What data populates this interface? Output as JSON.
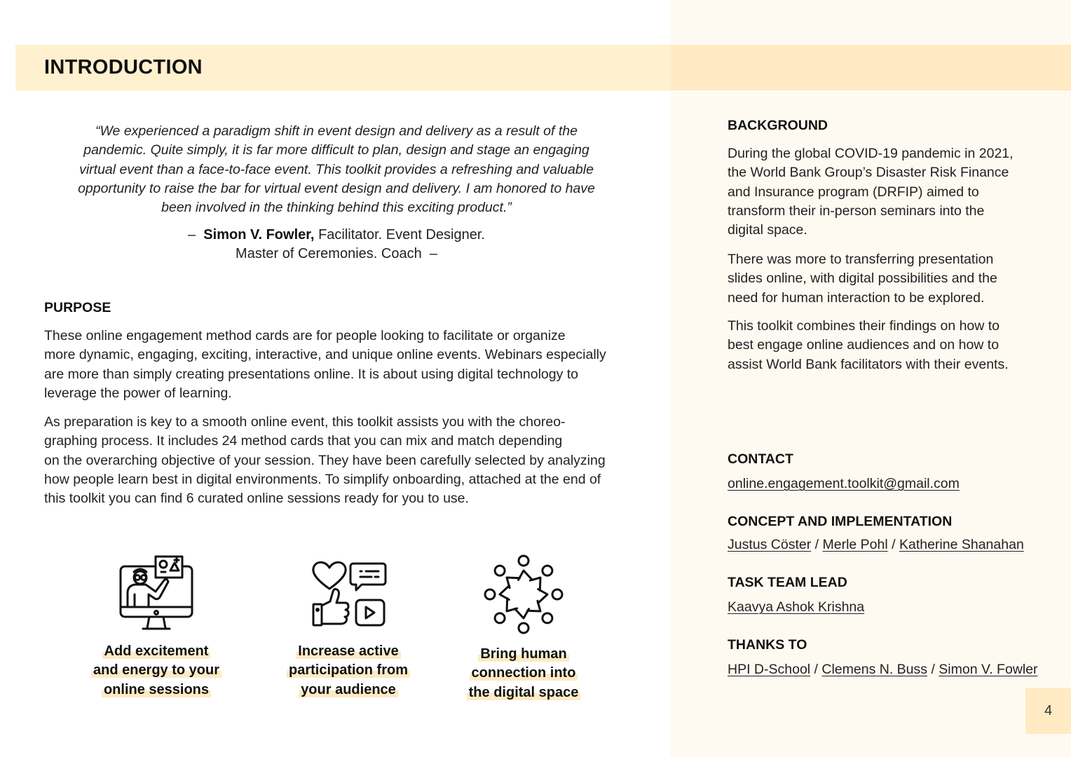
{
  "header": {
    "title": "INTRODUCTION"
  },
  "quote": {
    "lines": [
      "“We experienced a paradigm shift in event design and delivery as a result of the",
      "pandemic. Quite simply, it is far more difficult to plan, design and stage an engaging",
      "virtual event than a face-to-face event. This toolkit provides a refreshing and valuable",
      "opportunity to raise the bar for virtual event design and delivery. I am honored to have",
      "been involved in the thinking behind this exciting product.”"
    ],
    "dash": "–",
    "author": "Simon V. Fowler,",
    "role_line1": "Facilitator. Event Designer.",
    "role_line2": "Master of Ceremonies. Coach"
  },
  "purpose": {
    "heading": "PURPOSE",
    "paragraph1_lines": [
      "These online engagement method cards are for people looking to facilitate or organize",
      "more dynamic, engaging, exciting, interactive, and unique online events. Webinars especially",
      "are more than simply creating presentations online. It is about using digital technology to",
      "leverage the power of learning."
    ],
    "paragraph2_lines": [
      "As preparation is key to a smooth online event, this toolkit assists you with the choreo-",
      "graphing process. It includes 24 method cards that you can mix and match depending",
      "on the overarching objective of your session. They have been carefully selected by analyzing",
      "how people learn best in digital environments. To simplify onboarding, attached at the end of",
      "this toolkit you can find 6 curated online sessions ready for you to use."
    ]
  },
  "features": [
    {
      "icon": "presenter-screen-icon",
      "lines": [
        "Add excitement",
        "and energy to your",
        "online sessions"
      ]
    },
    {
      "icon": "engagement-reactions-icon",
      "lines": [
        "Increase active",
        "participation from",
        "your audience"
      ]
    },
    {
      "icon": "people-circle-icon",
      "lines": [
        "Bring human",
        "connection into",
        "the digital space"
      ]
    }
  ],
  "background": {
    "heading": "BACKGROUND",
    "paragraph1_lines": [
      "During the global COVID-19 pandemic in 2021,",
      "the World Bank Group’s Disaster Risk Finance",
      "and Insurance program (DRFIP) aimed to",
      "transform their in-person seminars into the",
      "digital space."
    ],
    "paragraph2_lines": [
      "There was more to transferring presentation",
      "slides online, with digital possibilities and the",
      "need for human interaction to be explored."
    ],
    "paragraph3_lines": [
      "This toolkit combines their findings on how to",
      "best engage online audiences and on how to",
      "assist World Bank facilitators with their events."
    ]
  },
  "contact": {
    "heading": "CONTACT",
    "email": "online.engagement.toolkit@gmail.com"
  },
  "concept": {
    "heading": "CONCEPT AND IMPLEMENTATION",
    "names": [
      "Justus Cöster",
      "Merle Pohl",
      "Katherine Shanahan"
    ]
  },
  "task_team_lead": {
    "heading": "TASK TEAM LEAD",
    "name": "Kaavya Ashok Krishna"
  },
  "thanks": {
    "heading": "THANKS TO",
    "names": [
      "HPI D-School",
      "Clemens N. Buss",
      "Simon V. Fowler"
    ]
  },
  "separator": " / ",
  "page_number": "4",
  "colors": {
    "header_band": "#fff0cf",
    "accent": "#ffeac4",
    "right_panel": "#fffaf1"
  }
}
